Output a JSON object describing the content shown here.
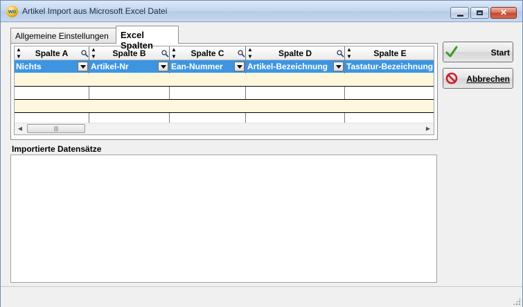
{
  "window": {
    "title": "Artikel Import aus Microsoft Excel Datei",
    "icon": "wo-app-icon",
    "icon_text": "wo"
  },
  "tabs": [
    {
      "label": "Allgemeine Einstellungen",
      "active": false
    },
    {
      "label": "Excel Spalten",
      "active": true
    }
  ],
  "grid": {
    "columns": [
      {
        "header": "Spalte A",
        "value": "Nichts"
      },
      {
        "header": "Spalte B",
        "value": "Artikel-Nr"
      },
      {
        "header": "Spalte C",
        "value": "Ean-Nummer"
      },
      {
        "header": "Spalte D",
        "value": "Artikel-Bezeichnung"
      },
      {
        "header": "Spalte E",
        "value": "Tastatur-Bezeichnung"
      }
    ],
    "selected_row_color": "#3d95e2",
    "row_color": "#fdf7dc"
  },
  "buttons": {
    "start_label": "Start",
    "cancel_label": "Abbrechen"
  },
  "import_section": {
    "label": "Importierte Datensätze"
  }
}
